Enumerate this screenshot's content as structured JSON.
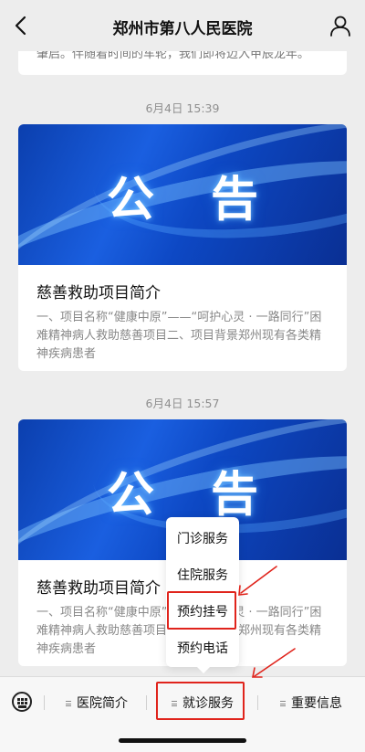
{
  "header": {
    "title": "郑州市第八人民医院"
  },
  "top_card": {
    "text": "肇启。伴随着时间的车轮，我们即将迈入甲辰龙年。"
  },
  "posts": [
    {
      "timestamp": "6月4日 15:39",
      "banner_text": "公告",
      "title": "慈善救助项目简介",
      "desc": "一、项目名称“健康中原”——“呵护心灵 · 一路同行”困难精神病人救助慈善项目二、项目背景郑州现有各类精神疾病患者"
    },
    {
      "timestamp": "6月4日 15:57",
      "banner_text": "公告",
      "title": "慈善救助项目简介",
      "desc": "一、项目名称“健康中原”——“呵护心灵 · 一路同行”困难精神病人救助慈善项目二、项目背景郑州现有各类精神疾病患者"
    }
  ],
  "popup_menu": {
    "items": [
      "门诊服务",
      "住院服务",
      "预约挂号",
      "预约电话"
    ]
  },
  "bottom_menu": {
    "tabs": [
      "医院简介",
      "就诊服务",
      "重要信息"
    ]
  },
  "colors": {
    "highlight": "#e0241c",
    "banner_blue": "#1a5fe0"
  }
}
